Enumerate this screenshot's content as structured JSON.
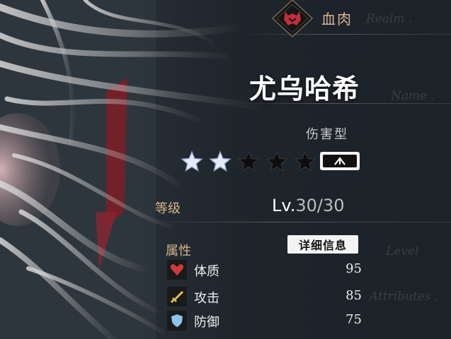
{
  "realm": {
    "name": "血肉",
    "ghost_label": "Realm ."
  },
  "character": {
    "name": "尤乌哈希",
    "name_ghost": "Name .",
    "type": "伤害型",
    "stars_filled": 2,
    "stars_total": 5
  },
  "level": {
    "label": "等级",
    "prefix": "Lv.",
    "current_max": "30/30",
    "ghost_label": "Level"
  },
  "attributes": {
    "label": "属性",
    "ghost_label": "Attributes .",
    "detail_button": "详细信息",
    "items": [
      {
        "label": "体质",
        "value": "95",
        "icon": "heart-icon"
      },
      {
        "label": "攻击",
        "value": "85",
        "icon": "sword-icon"
      },
      {
        "label": "防御",
        "value": "75",
        "icon": "shield-icon"
      }
    ]
  },
  "colors": {
    "gold_label": "#d7b48a",
    "realm_red": "#c0303a",
    "star_filled": "#e6ecf5",
    "star_empty": "#0d0d0d",
    "heart": "#d13a3a",
    "sword": "#e8c24a",
    "shield": "#8fc3ea"
  }
}
